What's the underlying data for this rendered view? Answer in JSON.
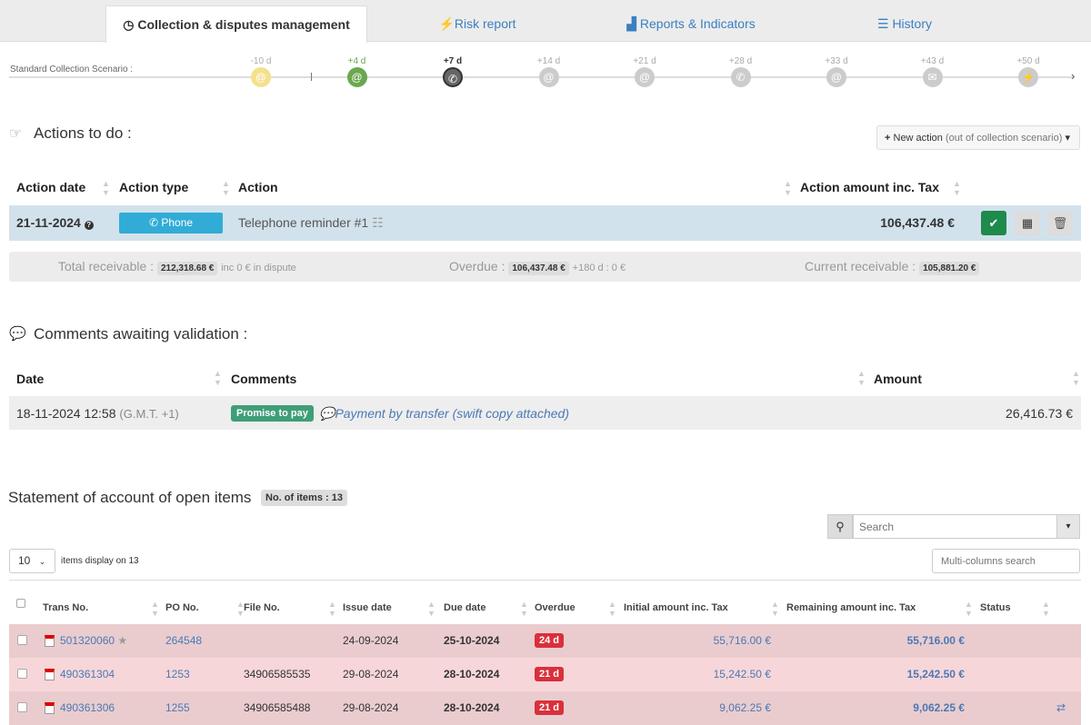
{
  "tabs": [
    {
      "label": "Collection & disputes management",
      "icon": "clock-icon",
      "active": true
    },
    {
      "label": "Risk report",
      "icon": "bolt-icon"
    },
    {
      "label": "Reports & Indicators",
      "icon": "bar-chart-icon"
    },
    {
      "label": "History",
      "icon": "list-icon"
    }
  ],
  "scenario": {
    "label": "Standard Collection Scenario :",
    "steps": [
      {
        "day": "-10 d",
        "icon": "at-icon",
        "color": "#f5e08e"
      },
      {
        "day": "+4 d",
        "icon": "at-icon",
        "color": "#6aa84f"
      },
      {
        "day": "+7 d",
        "icon": "phone-icon",
        "color": "#666666"
      },
      {
        "day": "+14 d",
        "icon": "at-icon",
        "color": "#cccccc"
      },
      {
        "day": "+21 d",
        "icon": "at-icon",
        "color": "#cccccc"
      },
      {
        "day": "+28 d",
        "icon": "phone-icon",
        "color": "#cccccc"
      },
      {
        "day": "+33 d",
        "icon": "at-icon",
        "color": "#cccccc"
      },
      {
        "day": "+43 d",
        "icon": "letter-icon",
        "color": "#cccccc"
      },
      {
        "day": "+50 d",
        "icon": "bolt-icon",
        "color": "#cccccc"
      }
    ]
  },
  "actions": {
    "title": "Actions to do :",
    "new_action": "New action",
    "new_action_sub": "(out of collection scenario)",
    "headers": [
      "Action date",
      "Action type",
      "Action",
      "Action amount inc. Tax"
    ],
    "row": {
      "date": "21-11-2024",
      "type": "Phone",
      "action": "Telephone reminder #1",
      "amount": "106,437.48 €"
    },
    "summary": {
      "total_label": "Total receivable",
      "total": "212,318.68 €",
      "dispute": "inc 0 € in dispute",
      "overdue_label": "Overdue",
      "overdue": "106,437.48 €",
      "overdue_180": "+180 d : 0 €",
      "current_label": "Current receivable",
      "current": "105,881.20 €"
    }
  },
  "comments": {
    "title": "Comments awaiting validation :",
    "headers": [
      "Date",
      "Comments",
      "Amount"
    ],
    "row": {
      "date": "18-11-2024 12:58",
      "tz": "(G.M.T. +1)",
      "tag": "Promise to pay",
      "text": "Payment by transfer (swift copy attached)",
      "amount": "26,416.73 €"
    }
  },
  "statement": {
    "title": "Statement of account of open items",
    "count": "No. of items : 13",
    "search_placeholder": "Search",
    "page_size": "10",
    "items_display": "items display on 13",
    "multi_placeholder": "Multi-columns search",
    "headers": [
      "Trans No.",
      "PO No.",
      "File No.",
      "Issue date",
      "Due date",
      "Overdue",
      "Initial amount inc. Tax",
      "Remaining amount inc. Tax",
      "Status"
    ],
    "rows": [
      {
        "trans": "501320060",
        "po": "264548",
        "file": "",
        "issue": "24-09-2024",
        "due": "25-10-2024",
        "overdue": "24 d",
        "initial": "55,716.00 €",
        "remaining": "55,716.00 €",
        "star": true
      },
      {
        "trans": "490361304",
        "po": "1253",
        "file": "34906585535",
        "issue": "29-08-2024",
        "due": "28-10-2024",
        "overdue": "21 d",
        "initial": "15,242.50 €",
        "remaining": "15,242.50 €"
      },
      {
        "trans": "490361306",
        "po": "1255",
        "file": "34906585488",
        "issue": "29-08-2024",
        "due": "28-10-2024",
        "overdue": "21 d",
        "initial": "9,062.25 €",
        "remaining": "9,062.25 €",
        "status_icon": "transfer-icon"
      }
    ]
  }
}
